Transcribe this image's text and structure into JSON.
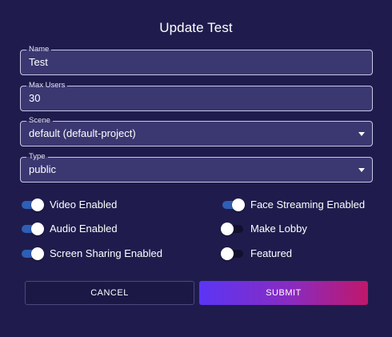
{
  "dialog": {
    "title": "Update Test"
  },
  "fields": {
    "name": {
      "label": "Name",
      "value": "Test"
    },
    "max_users": {
      "label": "Max Users",
      "value": "30"
    },
    "scene": {
      "label": "Scene",
      "value": "default (default-project)"
    },
    "type": {
      "label": "Type",
      "value": "public"
    }
  },
  "toggles": {
    "video": {
      "label": "Video Enabled",
      "checked": true
    },
    "audio": {
      "label": "Audio Enabled",
      "checked": true
    },
    "screen_sharing": {
      "label": "Screen Sharing Enabled",
      "checked": true
    },
    "face_streaming": {
      "label": "Face Streaming Enabled",
      "checked": true
    },
    "make_lobby": {
      "label": "Make Lobby",
      "checked": false
    },
    "featured": {
      "label": "Featured",
      "checked": false
    }
  },
  "buttons": {
    "cancel": "CANCEL",
    "submit": "SUBMIT"
  },
  "colors": {
    "background": "#1f1c4d",
    "field_background": "#3a3771",
    "switch_on_track": "#2e5fb4",
    "switch_off_track": "#12102e",
    "submit_gradient_start": "#5b35f5",
    "submit_gradient_end": "#c0176a"
  }
}
